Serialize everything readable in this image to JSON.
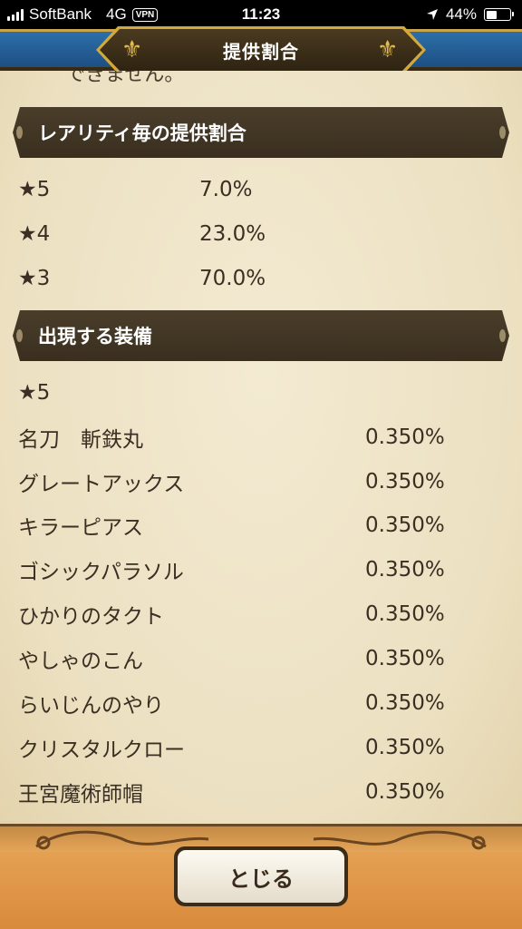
{
  "status_bar": {
    "carrier": "SoftBank",
    "network": "4G",
    "vpn": "VPN",
    "time": "11:23",
    "battery": "44%",
    "battery_level": 0.44
  },
  "header": {
    "title": "提供割合"
  },
  "content": {
    "cut_off_text": "できません。",
    "rarity_section": {
      "title": "レアリティ毎の提供割合",
      "rows": [
        {
          "label": "★5",
          "rate": "7.0%"
        },
        {
          "label": "★4",
          "rate": "23.0%"
        },
        {
          "label": "★3",
          "rate": "70.0%"
        }
      ]
    },
    "equipment_section": {
      "title": "出現する装備",
      "subheading": "★5",
      "items": [
        {
          "name": "名刀　斬鉄丸",
          "rate": "0.350%"
        },
        {
          "name": "グレートアックス",
          "rate": "0.350%"
        },
        {
          "name": "キラーピアス",
          "rate": "0.350%"
        },
        {
          "name": "ゴシックパラソル",
          "rate": "0.350%"
        },
        {
          "name": "ひかりのタクト",
          "rate": "0.350%"
        },
        {
          "name": "やしゃのこん",
          "rate": "0.350%"
        },
        {
          "name": "らいじんのやり",
          "rate": "0.350%"
        },
        {
          "name": "クリスタルクロー",
          "rate": "0.350%"
        },
        {
          "name": "王宮魔術師帽",
          "rate": "0.350%"
        }
      ]
    }
  },
  "footer": {
    "close_label": "とじる"
  }
}
